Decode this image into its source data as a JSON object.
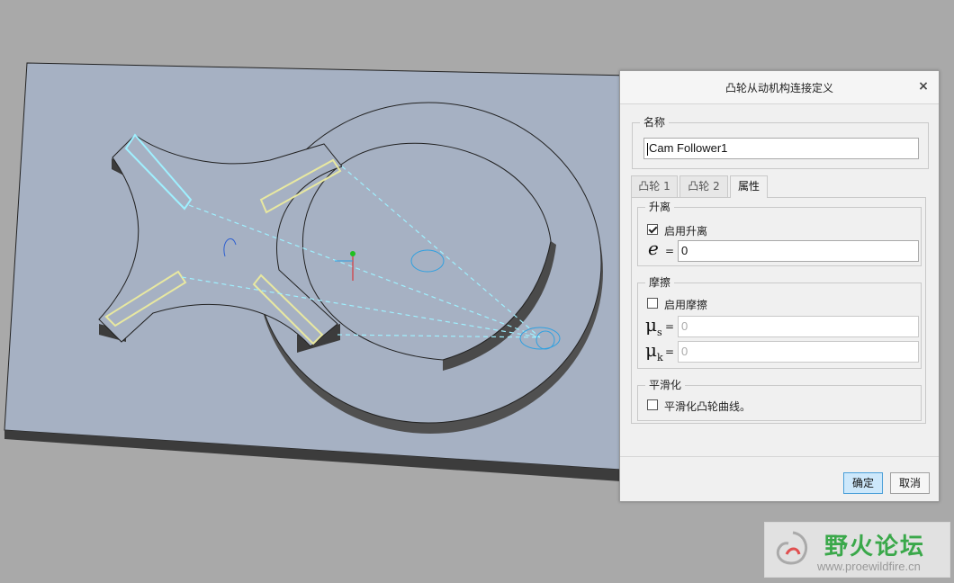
{
  "dialog": {
    "title": "凸轮从动机构连接定义",
    "close_glyph": "×",
    "name_group": {
      "legend": "名称",
      "value": "Cam Follower1"
    },
    "tabs": [
      {
        "label": "凸轮 1",
        "active": false
      },
      {
        "label": "凸轮 2",
        "active": false
      },
      {
        "label": "属性",
        "active": true
      }
    ],
    "liftoff": {
      "legend": "升离",
      "checkbox_label": "启用升离",
      "checked": true,
      "e_symbol": "e",
      "equals": "=",
      "e_value": "0"
    },
    "friction": {
      "legend": "摩擦",
      "checkbox_label": "启用摩擦",
      "checked": false,
      "mu": "μ",
      "s_sub": "s",
      "k_sub": "k",
      "equals": "=",
      "mu_s_value": "0",
      "mu_k_value": "0"
    },
    "smoothing": {
      "legend": "平滑化",
      "checkbox_label": "平滑化凸轮曲线。",
      "checked": false
    },
    "ok_label": "确定",
    "cancel_label": "取消"
  },
  "annotation": {
    "color": "#e02020"
  },
  "watermark": {
    "title": "野火论坛",
    "url": "www.proewildfire.cn"
  },
  "colors": {
    "background": "#a9a9a9",
    "plate": "#a6b1c3",
    "accent": "#cde8fb"
  }
}
